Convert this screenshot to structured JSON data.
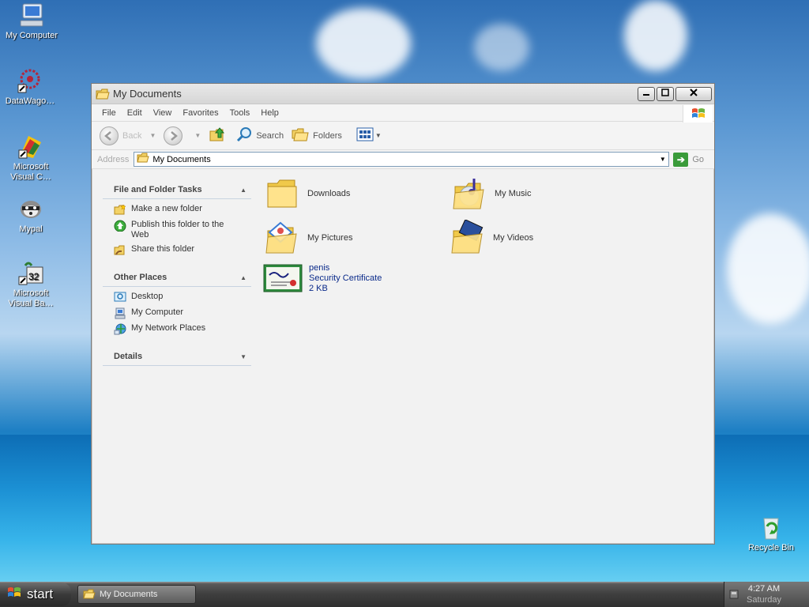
{
  "desktop": {
    "icons": [
      {
        "label": "My Computer",
        "icon": "my-computer-icon"
      },
      {
        "label": "DataWago…",
        "icon": "datawago-icon"
      },
      {
        "label": "Microsoft Visual C…",
        "icon": "visual-c-icon"
      },
      {
        "label": "Mypal",
        "icon": "mypal-icon"
      },
      {
        "label": "Microsoft Visual Ba…",
        "icon": "visual-basic-icon"
      },
      {
        "label": "Recycle Bin",
        "icon": "recycle-bin-icon"
      }
    ]
  },
  "window": {
    "title": "My Documents",
    "menu": [
      "File",
      "Edit",
      "View",
      "Favorites",
      "Tools",
      "Help"
    ],
    "toolbar": {
      "back": "Back",
      "search": "Search",
      "folders": "Folders"
    },
    "address": {
      "label": "Address",
      "value": "My Documents",
      "go": "Go"
    },
    "tasks": {
      "file_folder": {
        "title": "File and Folder Tasks",
        "items": [
          "Make a new folder",
          "Publish this folder to the Web",
          "Share this folder"
        ]
      },
      "other_places": {
        "title": "Other Places",
        "items": [
          "Desktop",
          "My Computer",
          "My Network Places"
        ]
      },
      "details": {
        "title": "Details"
      }
    },
    "files": [
      {
        "name": "Downloads",
        "icon": "folder-icon"
      },
      {
        "name": "My Music",
        "icon": "music-folder-icon"
      },
      {
        "name": "My Pictures",
        "icon": "pictures-folder-icon"
      },
      {
        "name": "My Videos",
        "icon": "videos-folder-icon"
      },
      {
        "name": "penis",
        "type": "Security Certificate",
        "size": "2 KB",
        "icon": "certificate-icon"
      }
    ]
  },
  "taskbar": {
    "start": "start",
    "task": "My Documents",
    "time": "4:27 AM",
    "day": "Saturday"
  }
}
